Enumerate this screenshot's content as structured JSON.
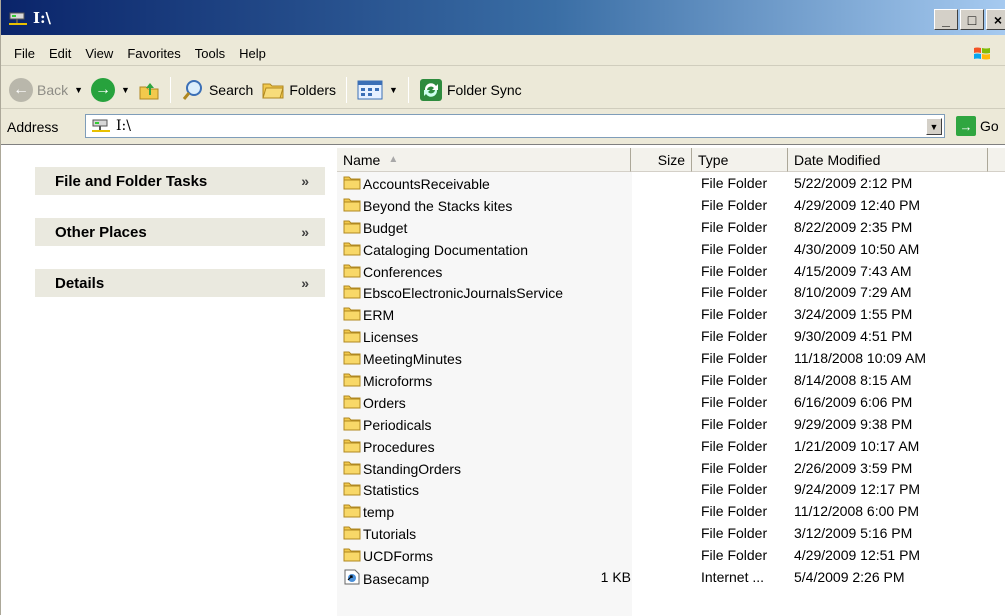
{
  "window": {
    "title": "I:\\"
  },
  "menu": [
    "File",
    "Edit",
    "View",
    "Favorites",
    "Tools",
    "Help"
  ],
  "toolbar": {
    "back_label": "Back",
    "search_label": "Search",
    "folders_label": "Folders",
    "folder_sync_label": "Folder Sync"
  },
  "address": {
    "label": "Address",
    "value": "I:\\",
    "go_label": "Go"
  },
  "taskpane": {
    "sections": [
      "File and Folder Tasks",
      "Other Places",
      "Details"
    ]
  },
  "columns": {
    "name": "Name",
    "size": "Size",
    "type": "Type",
    "date": "Date Modified"
  },
  "files": [
    {
      "name": "AccountsReceivable",
      "size": "",
      "type": "File Folder",
      "date": "5/22/2009 2:12 PM",
      "icon": "folder-icon"
    },
    {
      "name": "Beyond the Stacks kites",
      "size": "",
      "type": "File Folder",
      "date": "4/29/2009 12:40 PM",
      "icon": "folder-icon"
    },
    {
      "name": "Budget",
      "size": "",
      "type": "File Folder",
      "date": "8/22/2009 2:35 PM",
      "icon": "folder-icon"
    },
    {
      "name": "Cataloging Documentation",
      "size": "",
      "type": "File Folder",
      "date": "4/30/2009 10:50 AM",
      "icon": "folder-icon"
    },
    {
      "name": "Conferences",
      "size": "",
      "type": "File Folder",
      "date": "4/15/2009 7:43 AM",
      "icon": "folder-icon"
    },
    {
      "name": "EbscoElectronicJournalsService",
      "size": "",
      "type": "File Folder",
      "date": "8/10/2009 7:29 AM",
      "icon": "folder-icon"
    },
    {
      "name": "ERM",
      "size": "",
      "type": "File Folder",
      "date": "3/24/2009 1:55 PM",
      "icon": "folder-icon"
    },
    {
      "name": "Licenses",
      "size": "",
      "type": "File Folder",
      "date": "9/30/2009 4:51 PM",
      "icon": "folder-icon"
    },
    {
      "name": "MeetingMinutes",
      "size": "",
      "type": "File Folder",
      "date": "11/18/2008 10:09 AM",
      "icon": "folder-icon"
    },
    {
      "name": "Microforms",
      "size": "",
      "type": "File Folder",
      "date": "8/14/2008 8:15 AM",
      "icon": "folder-icon"
    },
    {
      "name": "Orders",
      "size": "",
      "type": "File Folder",
      "date": "6/16/2009 6:06 PM",
      "icon": "folder-icon"
    },
    {
      "name": "Periodicals",
      "size": "",
      "type": "File Folder",
      "date": "9/29/2009 9:38 PM",
      "icon": "folder-icon"
    },
    {
      "name": "Procedures",
      "size": "",
      "type": "File Folder",
      "date": "1/21/2009 10:17 AM",
      "icon": "folder-icon"
    },
    {
      "name": "StandingOrders",
      "size": "",
      "type": "File Folder",
      "date": "2/26/2009 3:59 PM",
      "icon": "folder-icon"
    },
    {
      "name": "Statistics",
      "size": "",
      "type": "File Folder",
      "date": "9/24/2009 12:17 PM",
      "icon": "folder-icon"
    },
    {
      "name": "temp",
      "size": "",
      "type": "File Folder",
      "date": "11/12/2008 6:00 PM",
      "icon": "folder-icon"
    },
    {
      "name": "Tutorials",
      "size": "",
      "type": "File Folder",
      "date": "3/12/2009 5:16 PM",
      "icon": "folder-icon"
    },
    {
      "name": "UCDForms",
      "size": "",
      "type": "File Folder",
      "date": "4/29/2009 12:51 PM",
      "icon": "folder-icon"
    },
    {
      "name": "Basecamp",
      "size": "1 KB",
      "type": "Internet ...",
      "date": "5/4/2009 2:26 PM",
      "icon": "internet-shortcut-icon"
    }
  ],
  "colors": {
    "title_start": "#0a246a",
    "title_end": "#a6caf0",
    "chrome": "#ece9d8",
    "folder": "#f2c94c",
    "taskpane_header": "#eae9df"
  }
}
